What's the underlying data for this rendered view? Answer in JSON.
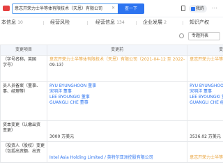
{
  "search": {
    "value": "意志开荣力士半等体有限技术（天恩）有限公司",
    "button_label": "查一下"
  },
  "top_right": {
    "user_label": "我的"
  },
  "tabs": [
    {
      "label": "本信息",
      "count": "10"
    },
    {
      "label": "经营风险",
      "count": ""
    },
    {
      "label": "经营信息",
      "count": "134"
    },
    {
      "label": "企业发展",
      "count": "2"
    },
    {
      "label": "知识产权",
      "count": ""
    }
  ],
  "toolbar": {
    "download_label": "专题列表"
  },
  "table": {
    "headers": [
      "变更项目",
      "变更前",
      "变更后"
    ],
    "rows": [
      {
        "item": [
          "（字号名称，英国",
          "字号）"
        ],
        "before": [
          "意志开荣力士半等体有限技术（天恩）有限公司（2021-04-12 至 2022-",
          "09-13）"
        ],
        "after": [
          "意志开荣力士半等体有限技术"
        ]
      },
      {
        "item": [
          "员人员备案（董事、",
          "事、经理等）"
        ],
        "before": [
          "RYU BYUNGHOON 董事",
          "宋明洋 董事",
          "LEE BYOUNGKI 董事",
          "GUANGLI CHE 董事"
        ],
        "after": [
          "RYU BYUNGHOON 董事",
          "宋明洋 董事",
          "LEE BYOUNGKI 董事",
          "GUANGLI CHE 经理"
        ]
      },
      {
        "item": [
          "资本变更（认缴出资",
          "变更）"
        ],
        "before": [
          "3000 万美元"
        ],
        "after": [
          "3536.02 万美元"
        ]
      },
      {
        "item": [
          "（投资人（股权）变更",
          "（包括出资额、出资"
        ],
        "before": [
          "Intel Asia Holding Limited / 英特尔亚洲控股有限公司"
        ],
        "after": [
          "意志开荣力士半等体有限技术（大连）"
        ]
      }
    ]
  }
}
